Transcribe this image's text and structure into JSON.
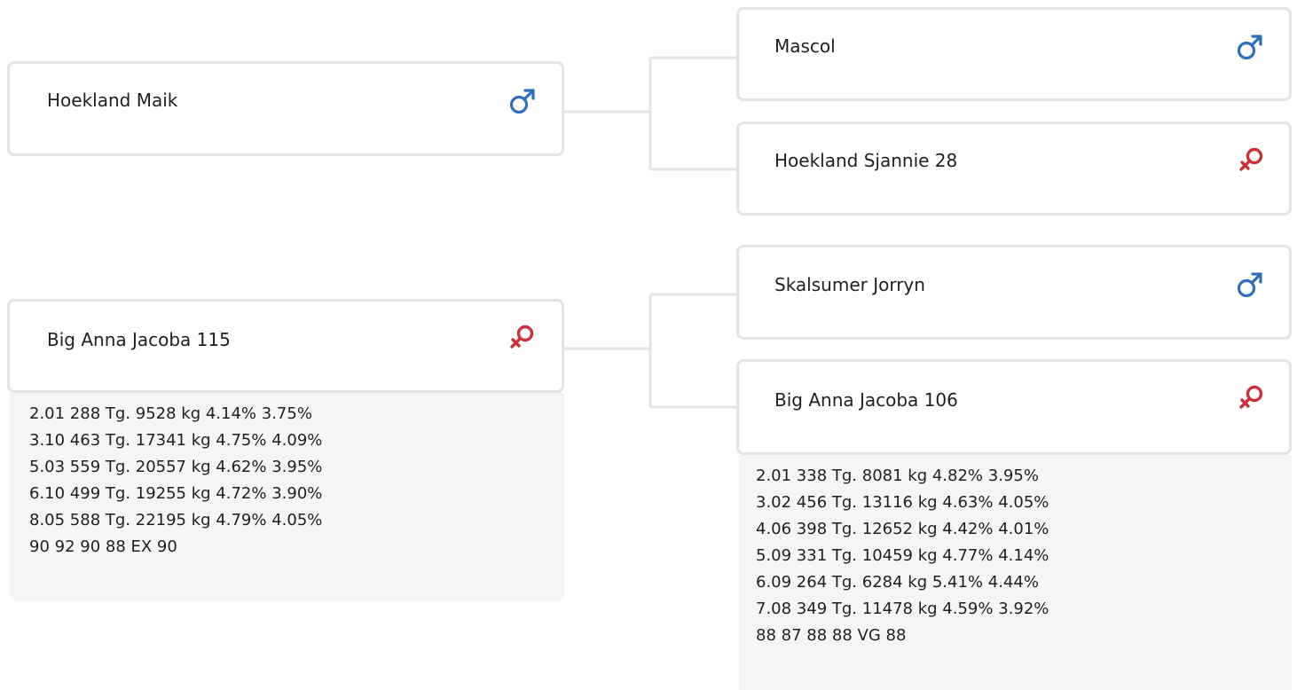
{
  "pedigree": {
    "sire": {
      "name": "Hoekland Maik",
      "sex": "male"
    },
    "dam": {
      "name": "Big Anna Jacoba 115",
      "sex": "female",
      "production": [
        "2.01 288 Tg. 9528 kg 4.14% 3.75%",
        "3.10 463 Tg. 17341 kg 4.75% 4.09%",
        "5.03 559 Tg. 20557 kg 4.62% 3.95%",
        "6.10 499 Tg. 19255 kg 4.72% 3.90%",
        "8.05 588 Tg. 22195 kg 4.79% 4.05%",
        "90 92 90 88 EX 90"
      ]
    },
    "sire_sire": {
      "name": "Mascol",
      "sex": "male"
    },
    "sire_dam": {
      "name": "Hoekland Sjannie 28",
      "sex": "female"
    },
    "dam_sire": {
      "name": "Skalsumer Jorryn",
      "sex": "male"
    },
    "dam_dam": {
      "name": "Big Anna Jacoba 106",
      "sex": "female",
      "production": [
        "2.01 338 Tg. 8081 kg 4.82% 3.95%",
        "3.02 456 Tg. 13116 kg 4.63% 4.05%",
        "4.06 398 Tg. 12652 kg 4.42% 4.01%",
        "5.09 331 Tg. 10459 kg 4.77% 4.14%",
        "6.09 264 Tg. 6284 kg 5.41% 4.44%",
        "7.08 349 Tg. 11478 kg 4.59% 3.92%",
        "88 87 88 88 VG 88"
      ]
    }
  },
  "colors": {
    "male": "#2f6fba",
    "female": "#c8323a",
    "border": "#e3e3e3",
    "details_bg": "#f5f5f5"
  },
  "icons": {
    "male": "male-symbol-icon",
    "female": "female-symbol-icon"
  }
}
